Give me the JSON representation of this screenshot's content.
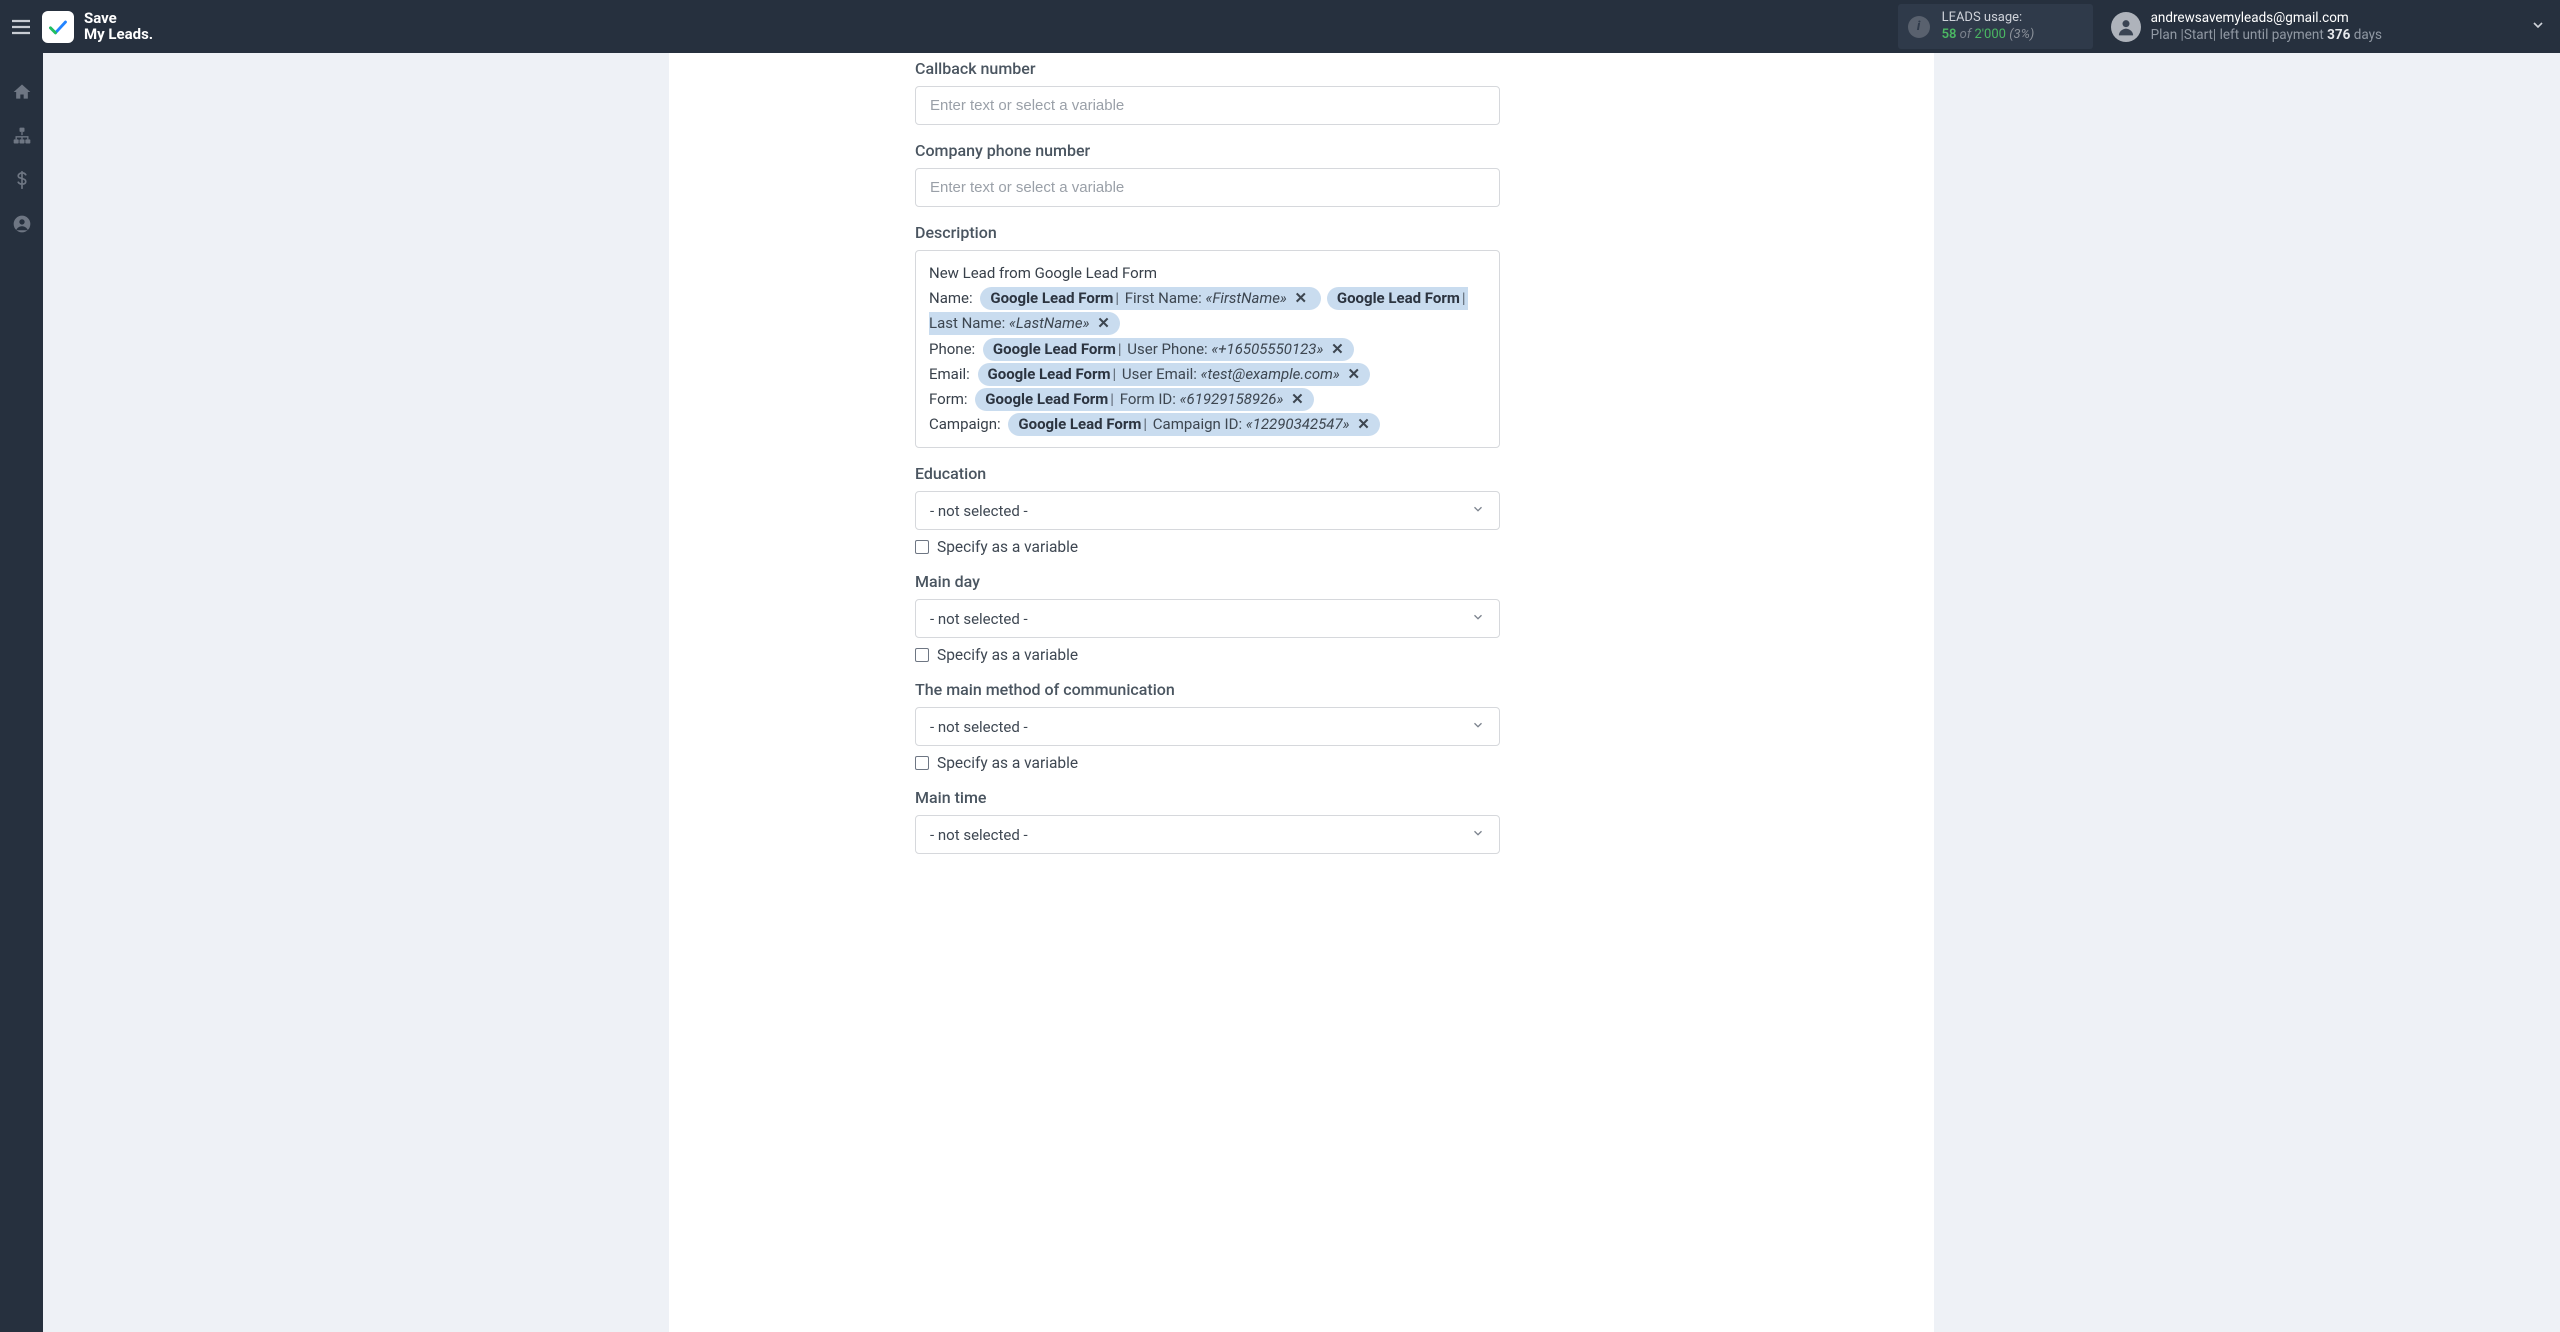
{
  "brand": {
    "line1": "Save",
    "line2": "My Leads."
  },
  "leads": {
    "title": "LEADS usage:",
    "used": "58",
    "of": "of",
    "total": "2'000",
    "pct": "(3%)"
  },
  "user": {
    "email": "andrewsavemyleads@gmail.com",
    "plan_prefix": "Plan",
    "plan_name": "|Start|",
    "plan_mid": "left until payment",
    "plan_days": "376",
    "plan_suffix": "days"
  },
  "form": {
    "callback_label": "Callback number",
    "callback_ph": "Enter text or select a variable",
    "company_label": "Company phone number",
    "company_ph": "Enter text or select a variable",
    "description_label": "Description",
    "desc_top": "New Lead from Google Lead Form",
    "rows": {
      "name_lbl": "Name:",
      "phone_lbl": "Phone:",
      "email_lbl": "Email:",
      "form_lbl": "Form:",
      "camp_lbl": "Campaign:"
    },
    "chips": {
      "src": "Google Lead Form",
      "first_name_field": "First Name:",
      "first_name_val": "«FirstName»",
      "last_name_field": "Last Name:",
      "last_name_val": "«LastName»",
      "phone_field": "User Phone:",
      "phone_val": "«+16505550123»",
      "email_field": "User Email:",
      "email_val": "«test@example.com»",
      "formid_field": "Form ID:",
      "formid_val": "«61929158926»",
      "campid_field": "Campaign ID:",
      "campid_val": "«12290342547»"
    },
    "not_selected": "- not selected -",
    "specify_var": "Specify as a variable",
    "education_label": "Education",
    "mainday_label": "Main day",
    "comm_label": "The main method of communication",
    "maintime_label": "Main time"
  }
}
